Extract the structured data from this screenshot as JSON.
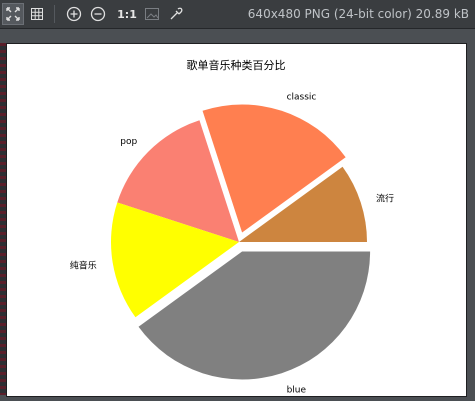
{
  "toolbar": {
    "zoom_label": "1:1",
    "image_info": "640x480 PNG (24-bit color) 20.89 kB",
    "icons": [
      "fit-icon",
      "grid-icon",
      "zoom-in-icon",
      "zoom-out-icon",
      "actual-size-icon",
      "image-icon",
      "eyedropper-icon"
    ]
  },
  "chart_data": {
    "type": "pie",
    "title": "歌单音乐种类百分比",
    "slices": [
      {
        "label": "流行",
        "value": 10,
        "color": "#cd853f",
        "exploded": false
      },
      {
        "label": "classic",
        "value": 20,
        "color": "#ff7f50",
        "exploded": true
      },
      {
        "label": "pop",
        "value": 15,
        "color": "#fa8072",
        "exploded": false
      },
      {
        "label": "纯音乐",
        "value": 15,
        "color": "#ffff00",
        "exploded": false
      },
      {
        "label": "blue",
        "value": 40,
        "color": "#808080",
        "exploded": true
      }
    ]
  }
}
